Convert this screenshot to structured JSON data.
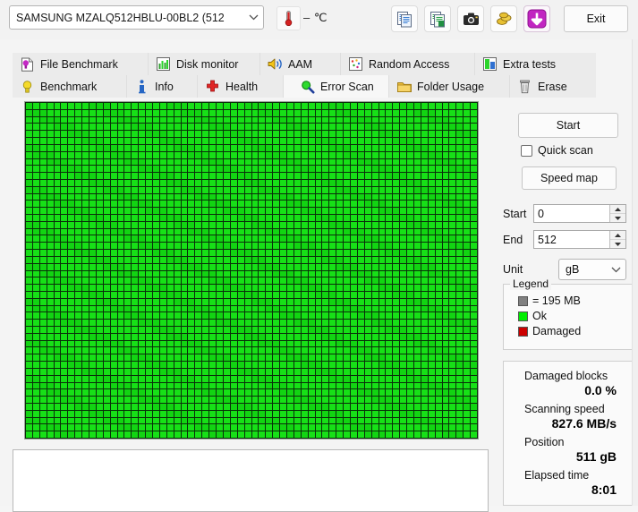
{
  "toolbar": {
    "drive_label": "SAMSUNG MZALQ512HBLU-00BL2 (512",
    "temperature": "– ℃",
    "icons": [
      {
        "name": "copy-report-icon"
      },
      {
        "name": "copy-report-excel-icon"
      },
      {
        "name": "camera-screenshot-icon"
      },
      {
        "name": "gold-coins-icon"
      },
      {
        "name": "download-update-icon"
      }
    ],
    "exit_label": "Exit"
  },
  "tabs": {
    "row1": [
      {
        "label": "File Benchmark",
        "icon": "file-benchmark-icon",
        "active": false
      },
      {
        "label": "Disk monitor",
        "icon": "disk-monitor-icon",
        "active": false
      },
      {
        "label": "AAM",
        "icon": "aam-speaker-icon",
        "active": false
      },
      {
        "label": "Random Access",
        "icon": "random-access-icon",
        "active": false
      },
      {
        "label": "Extra tests",
        "icon": "extra-tests-icon",
        "active": false
      }
    ],
    "row2": [
      {
        "label": "Benchmark",
        "icon": "benchmark-bulb-icon",
        "active": false
      },
      {
        "label": "Info",
        "icon": "info-icon",
        "active": false
      },
      {
        "label": "Health",
        "icon": "health-cross-icon",
        "active": false
      },
      {
        "label": "Error Scan",
        "icon": "error-scan-magnifier-icon",
        "active": true
      },
      {
        "label": "Folder Usage",
        "icon": "folder-usage-icon",
        "active": false
      },
      {
        "label": "Erase",
        "icon": "erase-trash-icon",
        "active": false
      }
    ]
  },
  "controls": {
    "start_label": "Start",
    "quick_scan_label": "Quick scan",
    "quick_scan_checked": false,
    "speed_map_label": "Speed map",
    "start_field_label": "Start",
    "start_field_value": "0",
    "end_field_label": "End",
    "end_field_value": "512",
    "unit_label": "Unit",
    "unit_value": "gB"
  },
  "legend": {
    "title": "Legend",
    "block_size_label": "= 195 MB",
    "ok_label": "Ok",
    "damaged_label": "Damaged",
    "block_color": "#808080",
    "ok_color": "#00ee00",
    "damaged_color": "#cc0000"
  },
  "stats": {
    "damaged_blocks_label": "Damaged blocks",
    "damaged_blocks_value": "0.0 %",
    "scanning_speed_label": "Scanning speed",
    "scanning_speed_value": "827.6 MB/s",
    "position_label": "Position",
    "position_value": "511 gB",
    "elapsed_time_label": "Elapsed time",
    "elapsed_time_value": "8:01"
  },
  "map": {
    "columns": 64,
    "rows": 48,
    "status": "ok",
    "ok_color": "#17e017",
    "grid_line_color": "#0a2f0a"
  },
  "log": {
    "text": ""
  }
}
